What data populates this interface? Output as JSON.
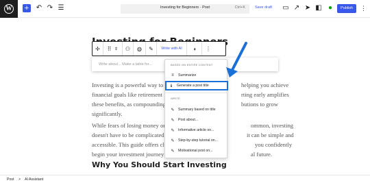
{
  "topbar": {
    "add_label": "+",
    "document_title": "Investing for Beginners · Post",
    "shortcut": "Ctrl+K",
    "save_draft": "Save draft",
    "publish": "Publish"
  },
  "post": {
    "title": "Investing for Beginners",
    "paragraph1": [
      "Investing is a powerful way to",
      "financial goals like retirement",
      "these benefits, as compounding",
      "significantly."
    ],
    "paragraph1_right": [
      "helping you achieve",
      "rting early amplifies",
      "butions to grow"
    ],
    "paragraph2": [
      "While fears of losing money or",
      "doesn't have to be complicated",
      "accessible. This guide offers cl",
      "begin your investment journey"
    ],
    "paragraph2_right": [
      "ommon, investing",
      "it can be simple and",
      "you confidently",
      "al future."
    ],
    "heading2": "Why You Should Start Investing"
  },
  "block_toolbar": {
    "write_with_ai": "Write with AI"
  },
  "ai_input": {
    "placeholder": "Write about... Make a table for..."
  },
  "dropdown": {
    "group_content": "BASED ON ENTIRE CONTENT",
    "items_content": [
      "Summarize",
      "Generate a post title"
    ],
    "group_write": "WRITE",
    "items_write": [
      "Summary based on title",
      "Post about...",
      "Informative article on...",
      "Step-by-step tutorial on...",
      "Motivational post on..."
    ]
  },
  "statusbar": {
    "crumb_root": "Post",
    "separator": ">",
    "crumb_current": "AI Assistant"
  },
  "colors": {
    "accent": "#3858e9",
    "highlight_border": "#1a6fd9",
    "arrow": "#1a6fd9"
  }
}
